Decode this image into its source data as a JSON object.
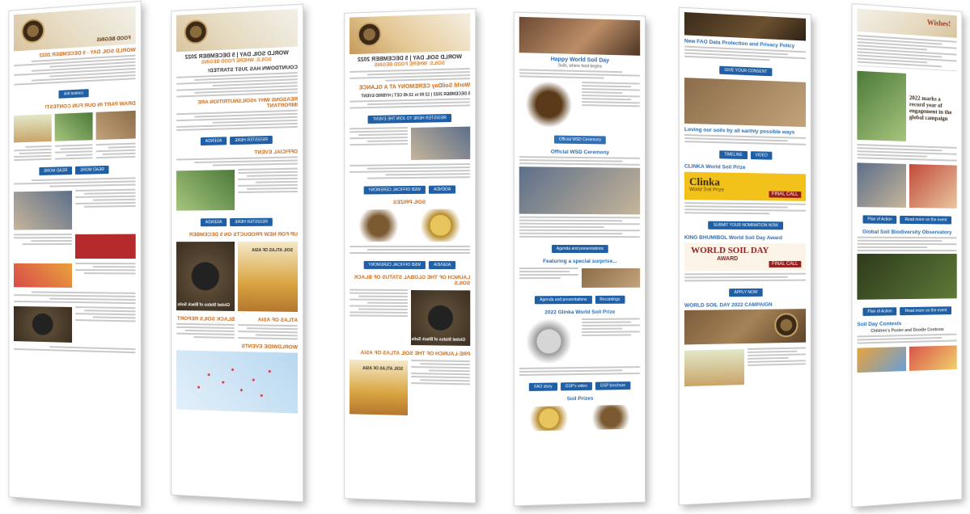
{
  "newsletter_1": {
    "banner_text": "FOOD BEGINS",
    "date_heading": "WORLD SOIL DAY - 5 DECEMBER 2022",
    "poster_heading": "DRAW PART IN OUR FUN CONTEST!",
    "button_1": "contest link",
    "button_2": "READ MORE"
  },
  "newsletter_2": {
    "title": "WORLD SOIL DAY | 5 DECEMBER 2022",
    "subtitle": "SOILS: WHERE FOOD BEGINS",
    "countdown": "COUNTDOWN HAS JUST STARTED!",
    "reasons": "REASONS WHY #SOILSNUTRITION ARE IMPORTANT",
    "official_event": "OFFICIAL EVENT",
    "new_products": "UP FOR NEW PRODUCTS ON 5 DECEMBER",
    "atlas": "ATLAS OF ASIA",
    "black_soils": "BLACK SOILS REPORT",
    "worldwide": "WORLDWIDE EVENTS",
    "btn_register": "REGISTER HERE",
    "btn_agenda": "AGENDA",
    "book_atlas": "SOIL ATLAS OF ASIA",
    "book_black": "Global Status of Black Soils"
  },
  "newsletter_3": {
    "title": "WORLD SOIL DAY | 5 DECEMBER 2022",
    "subtitle": "SOILS: WHERE FOOD BEGINS",
    "ceremony": "World SoilDay CEREMONY AT A GLANCE",
    "ceremony_date": "5 DECEMBER 2022 | 12:00 to 13:45 CET | HYBRID EVENT",
    "btn_register": "REGISTER HERE TO JOIN THE EVENT",
    "soil_prizes": "SOIL PRIZES",
    "launch": "LAUNCH OF THE GLOBAL STATUS OF BLACK SOILS",
    "prelaunch": "PRE-LAUNCH OF THE SOIL ATLAS OF ASIA",
    "btn_agenda": "AGENDA",
    "btn_web": "WEB OFFICIAL CEREMONY",
    "book_black": "Global Status of Black Soils",
    "book_atlas": "SOIL ATLAS OF ASIA"
  },
  "newsletter_4": {
    "title": "Happy World Soil Day",
    "quote": "Soils, where food begins",
    "official": "Official WSD Ceremony",
    "featuring": "Featuring a special surprise...",
    "glinka_award": "2022 Glinka World Soil Prize",
    "soil_prizes": "Soil Prizes",
    "btn_1": "FAO story",
    "btn_2": "GSP's video",
    "btn_3": "GSP brochure",
    "btn_agenda": "Agenda and presentations",
    "btn_recordings": "Recordings"
  },
  "newsletter_5": {
    "privacy": "New FAO Data Protection and Privacy Policy",
    "btn_consent": "GIVE YOUR CONSENT",
    "loving": "Loving our soils by all earthly possible ways",
    "clinka_heading": "CLINKA World Soil Prize",
    "clinka_logo": "Clinka",
    "clinka_sub": "World Soil Prize",
    "final_call": "FINAL CALL",
    "bhumibol": "KING BHUMIBOL World Soil Day Award",
    "wsd_logo": "WORLD SOIL DAY",
    "wsd_award": "AWARD",
    "campaign": "WORLD SOIL DAY 2022 CAMPAIGN",
    "btn_nominate": "SUBMIT YOUR NOMINATION NOW",
    "btn_apply": "APPLY NOW",
    "btn_timeline": "TIMELINE",
    "btn_video": "VIDEO"
  },
  "newsletter_6": {
    "wishes": "Wishes!",
    "record": "2022 marks a record year of engagement in the global campaign",
    "biodiversity": "Global Soil Biodiversity Observatory",
    "contest": "Soil Day Contests",
    "contest_sub": "Children's Poster and Doodle Contests",
    "btn_1": "Plan of Action",
    "btn_2": "Read more on the event"
  }
}
